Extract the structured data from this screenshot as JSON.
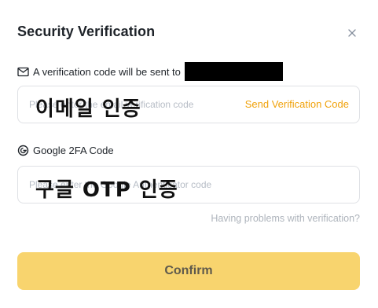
{
  "dialog": {
    "title": "Security Verification",
    "close_icon": "close-icon"
  },
  "email_section": {
    "icon": "mail-icon",
    "label": "A verification code will be sent to",
    "placeholder": "Please enter the email verification code",
    "send_code_label": "Send Verification Code",
    "overlay_annotation": "이메일 인증"
  },
  "google_section": {
    "icon": "google-icon",
    "label": "Google 2FA Code",
    "placeholder": "Please enter the Google Authenticator code",
    "overlay_annotation": "구글 OTP 인증"
  },
  "help_link": "Having problems with verification?",
  "confirm_button": "Confirm",
  "colors": {
    "accent": "#f0a20b",
    "confirm_bg": "#f8d46e",
    "muted_text": "#aeb4bc",
    "border": "#dfe1e5"
  }
}
